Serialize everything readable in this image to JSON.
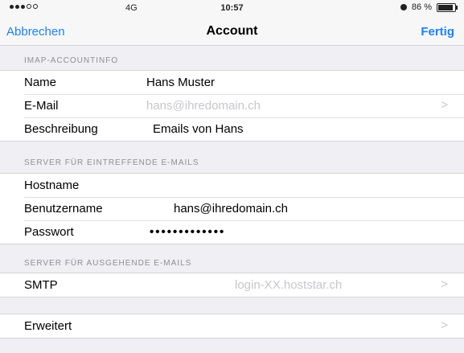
{
  "status_bar": {
    "carrier": "4G",
    "time": "10:57",
    "battery": "86 %"
  },
  "nav": {
    "cancel_label": "Abbrechen",
    "title": "Account",
    "done_label": "Fertig"
  },
  "imap_section": {
    "header": "IMAP-ACCOUNTINFO",
    "name_label": "Name",
    "name_value": "Hans Muster",
    "email_label": "E-Mail",
    "email_value": "hans@ihredomain.ch",
    "description_label": "Beschreibung",
    "description_value": "Emails von Hans"
  },
  "incoming_section": {
    "header": "SERVER FÜR EINTREFFENDE E-MAILS",
    "hostname_label": "Hostname",
    "username_label": "Benutzername",
    "username_value": "hans@ihredomain.ch",
    "password_label": "Passwort",
    "password_value": "•••••••••••••"
  },
  "outgoing_section": {
    "header": "SERVER FÜR AUSGEHENDE E-MAILS",
    "smtp_label": "SMTP",
    "smtp_value": "login-XX.hoststar.ch"
  },
  "advanced": {
    "label": "Erweitert"
  },
  "colors": {
    "accent": "#1a82fb",
    "background": "#efeff4"
  }
}
